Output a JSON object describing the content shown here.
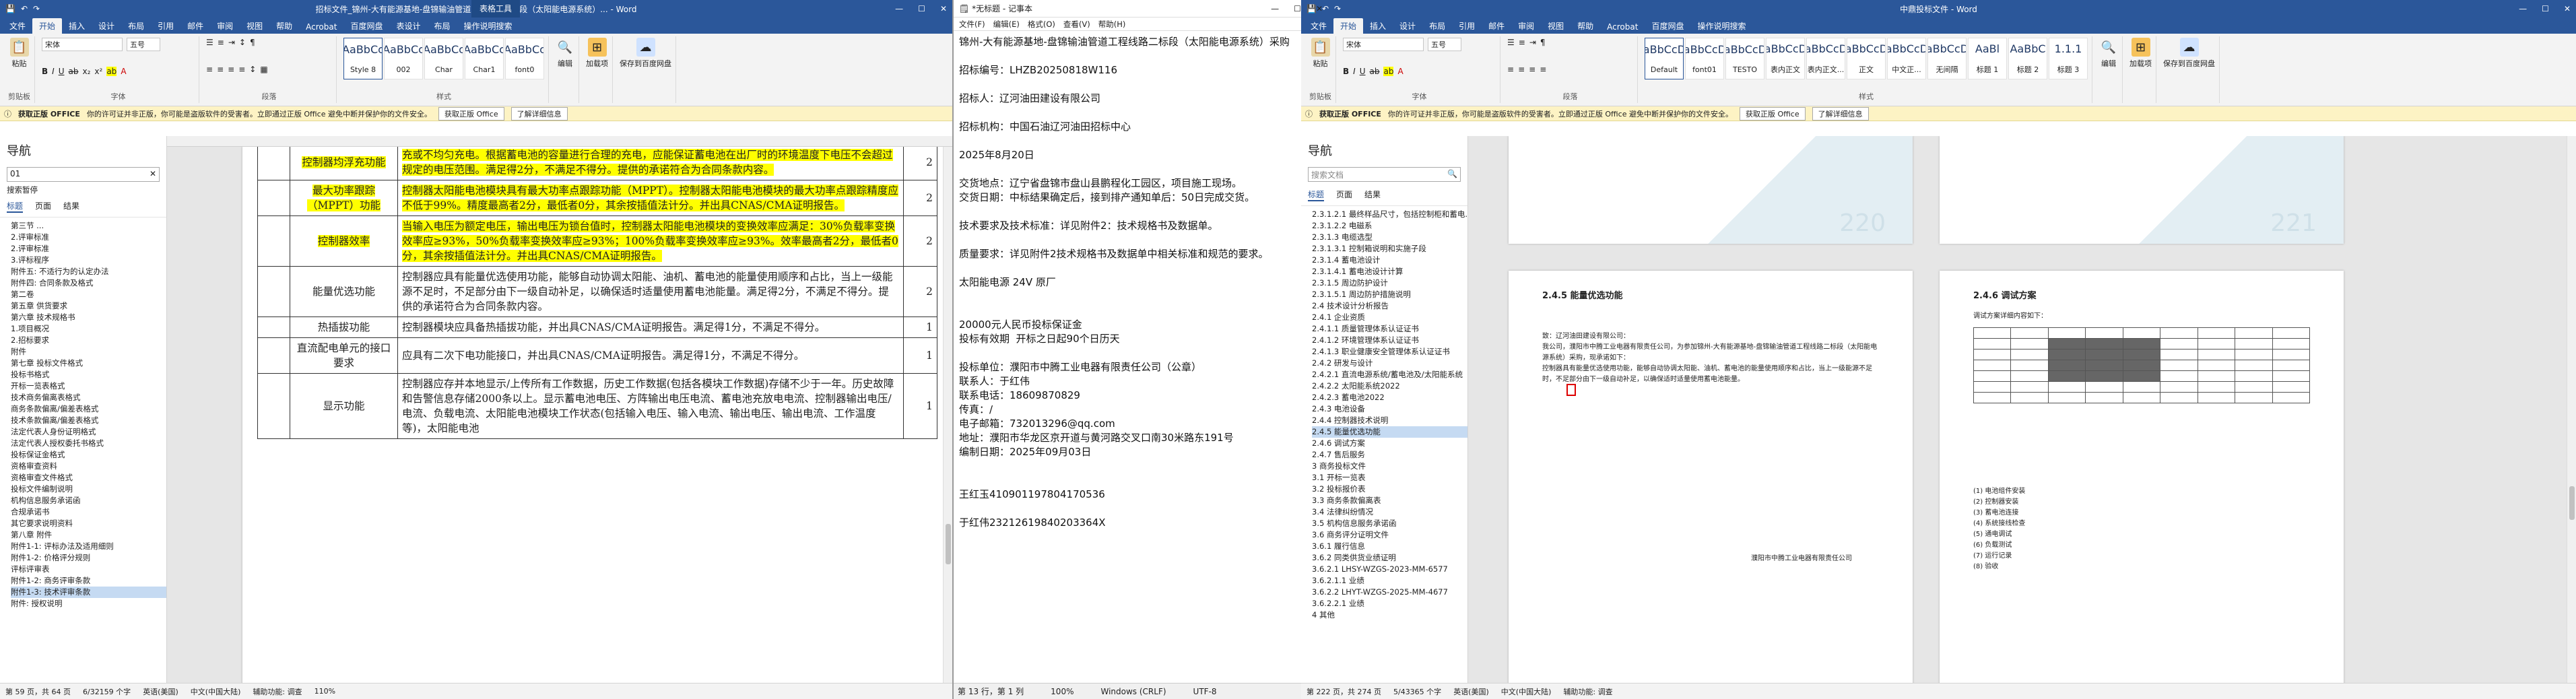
{
  "colors": {
    "word_blue": "#2b579a",
    "highlight": "#ffff00",
    "msgbar": "#fdf3c4"
  },
  "word1": {
    "title": "招标文件_锦州-大有能源基地-盘锦输油管道工程线路二标段（太阳能电源系统）... - Word",
    "context_tab": "表格工具",
    "tabs": [
      "文件",
      "开始",
      "插入",
      "设计",
      "布局",
      "引用",
      "邮件",
      "审阅",
      "视图",
      "帮助",
      "Acrobat",
      "百度网盘",
      "表设计",
      "布局",
      "操作说明搜索"
    ],
    "active_tab": "开始",
    "clipboard_label": "剪贴板",
    "paste": "粘贴",
    "font_name": "宋体",
    "font_size": "五号",
    "font_label": "字体",
    "para_label": "段落",
    "styles": [
      {
        "sample": "AaBbCc",
        "name": "Style 8"
      },
      {
        "sample": "AaBbCc",
        "name": "002"
      },
      {
        "sample": "AaBbCc",
        "name": "Char"
      },
      {
        "sample": "AaBbCc",
        "name": "Char1"
      },
      {
        "sample": "AaBbCc",
        "name": "font0"
      }
    ],
    "styles_label": "样式",
    "edit": "编辑",
    "addins": "加载项",
    "save_baidu": "保存到百度网盘",
    "save": "保存",
    "msg": {
      "badge": "获取正版 OFFICE",
      "text": "你的许可证并非正版，你可能是盗版软件的受害者。立即通过正版 Office 避免中断并保护你的文件安全。",
      "btn1": "获取正版 Office",
      "btn2": "了解详细信息"
    },
    "nav": {
      "title": "导航",
      "search": "01",
      "tabs": [
        "标题",
        "页面",
        "结果"
      ],
      "toc_label": "搜索暂停",
      "items": [
        "第三节 ...",
        "2.评审标准",
        "2.评审标准",
        "3.评标程序",
        "附件五: 不适行为的认定办法",
        "附件四: 合同条款及格式",
        "第二卷",
        "第五章 供货要求",
        "第六章 技术规格书",
        "1.项目概况",
        "2.招标要求",
        "附件",
        "第七章 投标文件格式",
        "投标书格式",
        "开标一览表格式",
        "技术商务偏离表格式",
        "商务条款偏离/偏差表格式",
        "技术条款偏离/偏差表格式",
        "法定代表人身份证明格式",
        "法定代表人授权委托书格式",
        "投标保证金格式",
        "资格审查资料",
        "资格审查文件格式",
        "投标文件编制说明",
        "机构信息服务承诺函",
        "合规承诺书",
        "其它要求说明资料",
        "第八章 附件",
        "附件1-1: 评标办法及适用细则",
        "附件1-2: 价格评分规则",
        "评标评审表",
        "附件1-2: 商务评审条款",
        "附件1-3: 技术评审条款",
        "附件: 授权说明"
      ],
      "active": 32
    },
    "table_rows": [
      {
        "num": "",
        "name": "控制器均浮充功能",
        "text": "充或不均匀充电。根据蓄电池的容量进行合理的充电，应能保证蓄电池在出厂时的环境温度下电压不会超过规定的电压范围。满足得2分，不满足不得分。提供的承诺符合为合同条款内容。",
        "score": "2",
        "hl": true
      },
      {
        "num": "",
        "name": "最大功率跟踪（MPPT）功能",
        "text": "控制器太阳能电池模块具有最大功率点跟踪功能（MPPT）。控制器太阳能电池模块的最大功率点跟踪精度应不低于99%。精度最高者2分，最低者0分，其余按插值法计分。并出具CNAS/CMA证明报告。",
        "score": "2",
        "hl": true
      },
      {
        "num": "",
        "name": "控制器效率",
        "text": "当输入电压为额定电压，输出电压为锁台值时，控制器太阳能电池模块的变换效率应满足：30%负载率变换效率应≥93%，50%负载率变换效率应≥93%；100%负载率变换效率应≥93%。效率最高者2分，最低者0分，其余按插值法计分。并出具CNAS/CMA证明报告。",
        "score": "2",
        "hl": true
      },
      {
        "num": "",
        "name": "能量优选功能",
        "text": "控制器应具有能量优选使用功能，能够自动协调太阳能、油机、蓄电池的能量使用顺序和占比，当上一级能源不足时，不足部分由下一级自动补足，以确保适时适量使用蓄电池能量。满足得2分，不满足不得分。提供的承诺符合为合同条款内容。",
        "score": "2",
        "hl": false
      },
      {
        "num": "",
        "name": "热插拔功能",
        "text": "控制器模块应具备热插拔功能，并出具CNAS/CMA证明报告。满足得1分，不满足不得分。",
        "score": "1",
        "hl": false
      },
      {
        "num": "",
        "name": "直流配电单元的接口要求",
        "text": "应具有二次下电功能接口，并出具CNAS/CMA证明报告。满足得1分，不满足不得分。",
        "score": "1",
        "hl": false
      },
      {
        "num": "",
        "name": "显示功能",
        "text": "控制器应存并本地显示/上传所有工作数据，历史工作数据(包括各模块工作数据)存储不少于一年。历史故障和告警信息存储2000条以上。显示蓄电池电压、方阵输出电压电流、蓄电池充放电电流、控制器输出电压/电流、负载电流、太阳能电池模块工作状态(包括输入电压、输入电流、输出电压、输出电流、工作温度等)，太阳能电池",
        "score": "1",
        "hl": false
      }
    ],
    "status": [
      "第 59 页，共 64 页",
      "6/32159 个字",
      "英语(美国)",
      "中文(中国大陆)",
      "辅助功能: 调查",
      "110%"
    ]
  },
  "notepad": {
    "title": "*无标题 - 记事本",
    "menu": [
      "文件(F)",
      "编辑(E)",
      "格式(O)",
      "查看(V)",
      "帮助(H)"
    ],
    "text": "锦州-大有能源基地-盘锦输油管道工程线路二标段（太阳能电源系统）采购\n\n招标编号：LHZB20250818W116\n\n招标人：辽河油田建设有限公司\n\n招标机构：中国石油辽河油田招标中心\n\n2025年8月20日\n\n交货地点：辽宁省盘锦市盘山县鹏程化工园区，项目施工现场。\n交货日期：中标结果确定后，接到排产通知单后：50日完成交货。\n\n技术要求及技术标准：详见附件2：技术规格书及数据单。\n\n质量要求：详见附件2技术规格书及数据单中相关标准和规范的要求。\n\n太阳能电源 24V 原厂\n\n\n20000元人民币投标保证金\n投标有效期  开标之日起90个日历天\n\n投标单位：濮阳市中腾工业电器有限责任公司（公章）\n联系人：于红伟\n联系电话：18609870829\n传真：/\n电子邮箱：732013296@qq.com\n地址：濮阳市华龙区京开道与黄河路交叉口南30米路东191号\n编制日期：2025年09月03日\n\n\n王红玉410901197804170536\n\n于红伟23212619840203364X",
    "status": [
      "第 13 行，第 1 列",
      "100%",
      "Windows (CRLF)",
      "UTF-8"
    ]
  },
  "word2": {
    "title": "中鼎投标文件 - Word",
    "tabs": [
      "文件",
      "开始",
      "插入",
      "设计",
      "布局",
      "引用",
      "邮件",
      "审阅",
      "视图",
      "帮助",
      "Acrobat",
      "百度网盘",
      "操作说明搜索"
    ],
    "active_tab": "开始",
    "font_name": "宋体",
    "font_size": "五号",
    "styles": [
      {
        "sample": "AaBbCcDd",
        "name": "Default"
      },
      {
        "sample": "AaBbCcDd",
        "name": "font01"
      },
      {
        "sample": "AaBbCcDd",
        "name": "TESTO"
      },
      {
        "sample": "AaBbCcDd",
        "name": "表内正文"
      },
      {
        "sample": "AaBbCcDd",
        "name": "表内正文..."
      },
      {
        "sample": "AaBbCcDd",
        "name": "正文"
      },
      {
        "sample": "AaBbCcDd",
        "name": "中文正..."
      },
      {
        "sample": "AaBbCcDd",
        "name": "无间隔"
      },
      {
        "sample": "AaBl",
        "name": "标题 1"
      },
      {
        "sample": "AaBbC",
        "name": "标题 2"
      },
      {
        "sample": "1.1.1",
        "name": "标题 3"
      }
    ],
    "msg": {
      "badge": "获取正版 OFFICE",
      "text": "你的许可证并非正版，你可能是盗版软件的受害者。立即通过正版 Office 避免中断并保护你的文件安全。",
      "btn1": "获取正版 Office",
      "btn2": "了解详细信息"
    },
    "nav": {
      "title": "导航",
      "search": "搜索文档",
      "tabs": [
        "标题",
        "页面",
        "结果"
      ],
      "items": [
        "2.3.1.2.1 最终样品尺寸，包括控制柜和蓄电...",
        "2.3.1.2.2 电磁系",
        "2.3.1.3 电缆选型",
        "2.3.1.3.1 控制箱说明和实施子段",
        "2.3.1.4 蓄电池设计",
        "2.3.1.4.1 蓄电池设计计算",
        "2.3.1.5 周边防护设计",
        "2.3.1.5.1 周边防护措施说明",
        "2.4 技术设计分析报告",
        "2.4.1 企业资质",
        "2.4.1.1 质量管理体系认证证书",
        "2.4.1.2 环境管理体系认证证书",
        "2.4.1.3 职业健康安全管理体系认证证书",
        "2.4.2 研发与设计",
        "2.4.2.1 直流电源系统/蓄电池及/太阳能系统",
        "2.4.2.2 太阳能系统2022",
        "2.4.2.3 蓄电池2022",
        "2.4.3 电池设备",
        "2.4.4 控制器技术说明",
        "2.4.5 能量优选功能",
        "2.4.6 调试方案",
        "2.4.7 售后服务",
        "3 商务投标文件",
        "3.1 开标一览表",
        "3.2 投标报价表",
        "3.3 商务条款偏离表",
        "3.4 法律纠纷情况",
        "3.5 机构信息服务承诺函",
        "3.6 商务评分证明文件",
        "3.6.1 履行信息",
        "3.6.2 同类供货业绩证明",
        "3.6.2.1 LHSY-WZGS-2023-MM-6577",
        "3.6.2.1.1 业绩",
        "3.6.2.2 LHYT-WZGS-2025-MM-4677",
        "3.6.2.2.1 业绩",
        "4 其他"
      ],
      "active": 19
    },
    "page_num_a": "220",
    "page_num_b": "221",
    "heading_left": "2.4.5 能量优选功能",
    "heading_right": "2.4.6 调试方案",
    "left_text": "致：辽河油田建设有限公司：\n我公司，濮阳市中腾工业电器有限责任公司，为参加锦州-大有能源基地-盘锦输油管道工程线路二标段（太阳能电源系统）采购，现承诺如下：\n控制器具有能量优选使用功能，能够自动协调太阳能、油机、蓄电池的能量使用顺序和占比，当上一级能源不足时，不足部分由下一级自动补足，以确保适时适量使用蓄电池能量。",
    "left_sign": "濮阳市中腾工业电器有限责任公司",
    "right_intro": "调试方案详细内容如下：",
    "right_list": [
      "(1) 电池组件安装",
      "(2) 控制器安装",
      "(3) 蓄电池连接",
      "(4) 系统接线检查",
      "(5) 通电调试",
      "(6) 负载测试",
      "(7) 运行记录",
      "(8) 验收"
    ],
    "status": [
      "第 222 页，共 274 页",
      "5/43365 个字",
      "英语(美国)",
      "中文(中国大陆)",
      "辅助功能: 调查"
    ]
  }
}
